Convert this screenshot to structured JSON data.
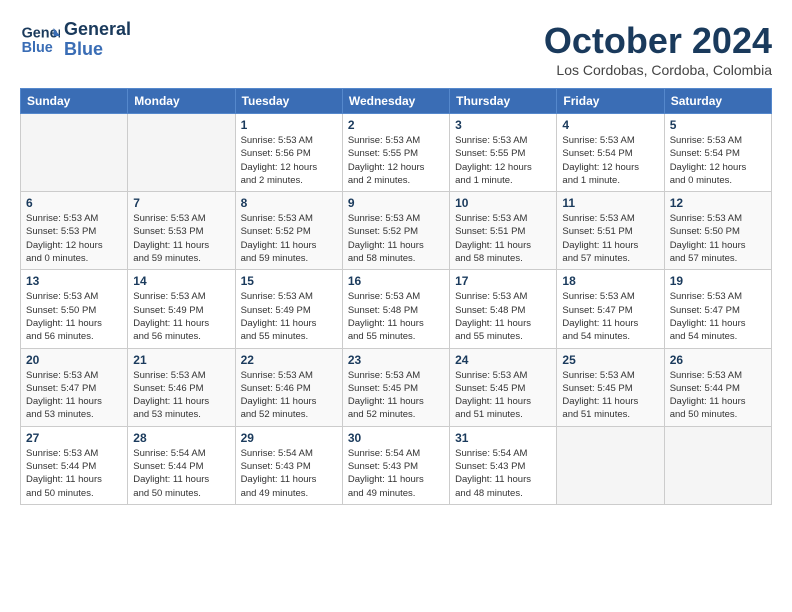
{
  "logo": {
    "line1": "General",
    "line2": "Blue"
  },
  "title": "October 2024",
  "subtitle": "Los Cordobas, Cordoba, Colombia",
  "weekdays": [
    "Sunday",
    "Monday",
    "Tuesday",
    "Wednesday",
    "Thursday",
    "Friday",
    "Saturday"
  ],
  "weeks": [
    [
      {
        "day": "",
        "info": ""
      },
      {
        "day": "",
        "info": ""
      },
      {
        "day": "1",
        "info": "Sunrise: 5:53 AM\nSunset: 5:56 PM\nDaylight: 12 hours\nand 2 minutes."
      },
      {
        "day": "2",
        "info": "Sunrise: 5:53 AM\nSunset: 5:55 PM\nDaylight: 12 hours\nand 2 minutes."
      },
      {
        "day": "3",
        "info": "Sunrise: 5:53 AM\nSunset: 5:55 PM\nDaylight: 12 hours\nand 1 minute."
      },
      {
        "day": "4",
        "info": "Sunrise: 5:53 AM\nSunset: 5:54 PM\nDaylight: 12 hours\nand 1 minute."
      },
      {
        "day": "5",
        "info": "Sunrise: 5:53 AM\nSunset: 5:54 PM\nDaylight: 12 hours\nand 0 minutes."
      }
    ],
    [
      {
        "day": "6",
        "info": "Sunrise: 5:53 AM\nSunset: 5:53 PM\nDaylight: 12 hours\nand 0 minutes."
      },
      {
        "day": "7",
        "info": "Sunrise: 5:53 AM\nSunset: 5:53 PM\nDaylight: 11 hours\nand 59 minutes."
      },
      {
        "day": "8",
        "info": "Sunrise: 5:53 AM\nSunset: 5:52 PM\nDaylight: 11 hours\nand 59 minutes."
      },
      {
        "day": "9",
        "info": "Sunrise: 5:53 AM\nSunset: 5:52 PM\nDaylight: 11 hours\nand 58 minutes."
      },
      {
        "day": "10",
        "info": "Sunrise: 5:53 AM\nSunset: 5:51 PM\nDaylight: 11 hours\nand 58 minutes."
      },
      {
        "day": "11",
        "info": "Sunrise: 5:53 AM\nSunset: 5:51 PM\nDaylight: 11 hours\nand 57 minutes."
      },
      {
        "day": "12",
        "info": "Sunrise: 5:53 AM\nSunset: 5:50 PM\nDaylight: 11 hours\nand 57 minutes."
      }
    ],
    [
      {
        "day": "13",
        "info": "Sunrise: 5:53 AM\nSunset: 5:50 PM\nDaylight: 11 hours\nand 56 minutes."
      },
      {
        "day": "14",
        "info": "Sunrise: 5:53 AM\nSunset: 5:49 PM\nDaylight: 11 hours\nand 56 minutes."
      },
      {
        "day": "15",
        "info": "Sunrise: 5:53 AM\nSunset: 5:49 PM\nDaylight: 11 hours\nand 55 minutes."
      },
      {
        "day": "16",
        "info": "Sunrise: 5:53 AM\nSunset: 5:48 PM\nDaylight: 11 hours\nand 55 minutes."
      },
      {
        "day": "17",
        "info": "Sunrise: 5:53 AM\nSunset: 5:48 PM\nDaylight: 11 hours\nand 55 minutes."
      },
      {
        "day": "18",
        "info": "Sunrise: 5:53 AM\nSunset: 5:47 PM\nDaylight: 11 hours\nand 54 minutes."
      },
      {
        "day": "19",
        "info": "Sunrise: 5:53 AM\nSunset: 5:47 PM\nDaylight: 11 hours\nand 54 minutes."
      }
    ],
    [
      {
        "day": "20",
        "info": "Sunrise: 5:53 AM\nSunset: 5:47 PM\nDaylight: 11 hours\nand 53 minutes."
      },
      {
        "day": "21",
        "info": "Sunrise: 5:53 AM\nSunset: 5:46 PM\nDaylight: 11 hours\nand 53 minutes."
      },
      {
        "day": "22",
        "info": "Sunrise: 5:53 AM\nSunset: 5:46 PM\nDaylight: 11 hours\nand 52 minutes."
      },
      {
        "day": "23",
        "info": "Sunrise: 5:53 AM\nSunset: 5:45 PM\nDaylight: 11 hours\nand 52 minutes."
      },
      {
        "day": "24",
        "info": "Sunrise: 5:53 AM\nSunset: 5:45 PM\nDaylight: 11 hours\nand 51 minutes."
      },
      {
        "day": "25",
        "info": "Sunrise: 5:53 AM\nSunset: 5:45 PM\nDaylight: 11 hours\nand 51 minutes."
      },
      {
        "day": "26",
        "info": "Sunrise: 5:53 AM\nSunset: 5:44 PM\nDaylight: 11 hours\nand 50 minutes."
      }
    ],
    [
      {
        "day": "27",
        "info": "Sunrise: 5:53 AM\nSunset: 5:44 PM\nDaylight: 11 hours\nand 50 minutes."
      },
      {
        "day": "28",
        "info": "Sunrise: 5:54 AM\nSunset: 5:44 PM\nDaylight: 11 hours\nand 50 minutes."
      },
      {
        "day": "29",
        "info": "Sunrise: 5:54 AM\nSunset: 5:43 PM\nDaylight: 11 hours\nand 49 minutes."
      },
      {
        "day": "30",
        "info": "Sunrise: 5:54 AM\nSunset: 5:43 PM\nDaylight: 11 hours\nand 49 minutes."
      },
      {
        "day": "31",
        "info": "Sunrise: 5:54 AM\nSunset: 5:43 PM\nDaylight: 11 hours\nand 48 minutes."
      },
      {
        "day": "",
        "info": ""
      },
      {
        "day": "",
        "info": ""
      }
    ]
  ]
}
